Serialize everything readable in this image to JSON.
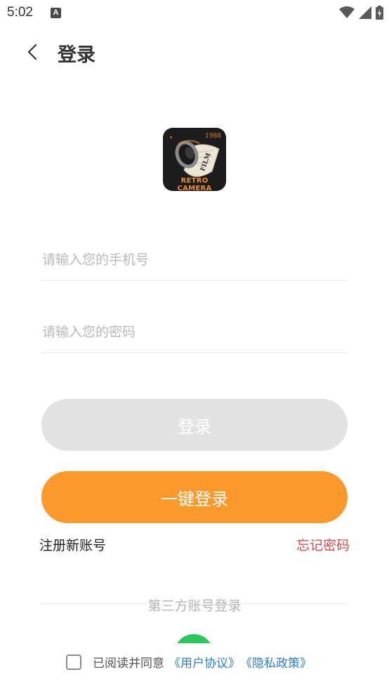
{
  "status_bar": {
    "time": "5:02",
    "notification_icon_letter": "A",
    "icons": [
      "notification-a-icon",
      "wifi-icon",
      "cellular-signal-icon",
      "battery-charging-icon"
    ]
  },
  "app_bar": {
    "back_icon": "chevron-left-icon",
    "title": "登录"
  },
  "logo": {
    "year_text": "1988",
    "film_text": "FILM",
    "brand_text": "RETRO CAMERA"
  },
  "form": {
    "phone_placeholder": "请输入您的手机号",
    "phone_value": "",
    "password_placeholder": "请输入您的密码",
    "password_value": ""
  },
  "buttons": {
    "login_label": "登录",
    "one_key_login_label": "一键登录"
  },
  "links": {
    "register": "注册新账号",
    "forgot_password": "忘记密码"
  },
  "third_party": {
    "heading": "第三方账号登录",
    "icons": [
      "wechat-icon"
    ]
  },
  "agreement": {
    "checked": false,
    "prefix": "已阅读并同意",
    "user_agreement": "《用户协议》",
    "privacy_policy": "《隐私政策》"
  },
  "colors": {
    "primary_orange": "#fb9a2a",
    "disabled_gray": "#e2e2e2",
    "forgot_red": "#e24b4b",
    "link_blue": "#2f7fd6",
    "wechat_green": "#2cc65f"
  }
}
